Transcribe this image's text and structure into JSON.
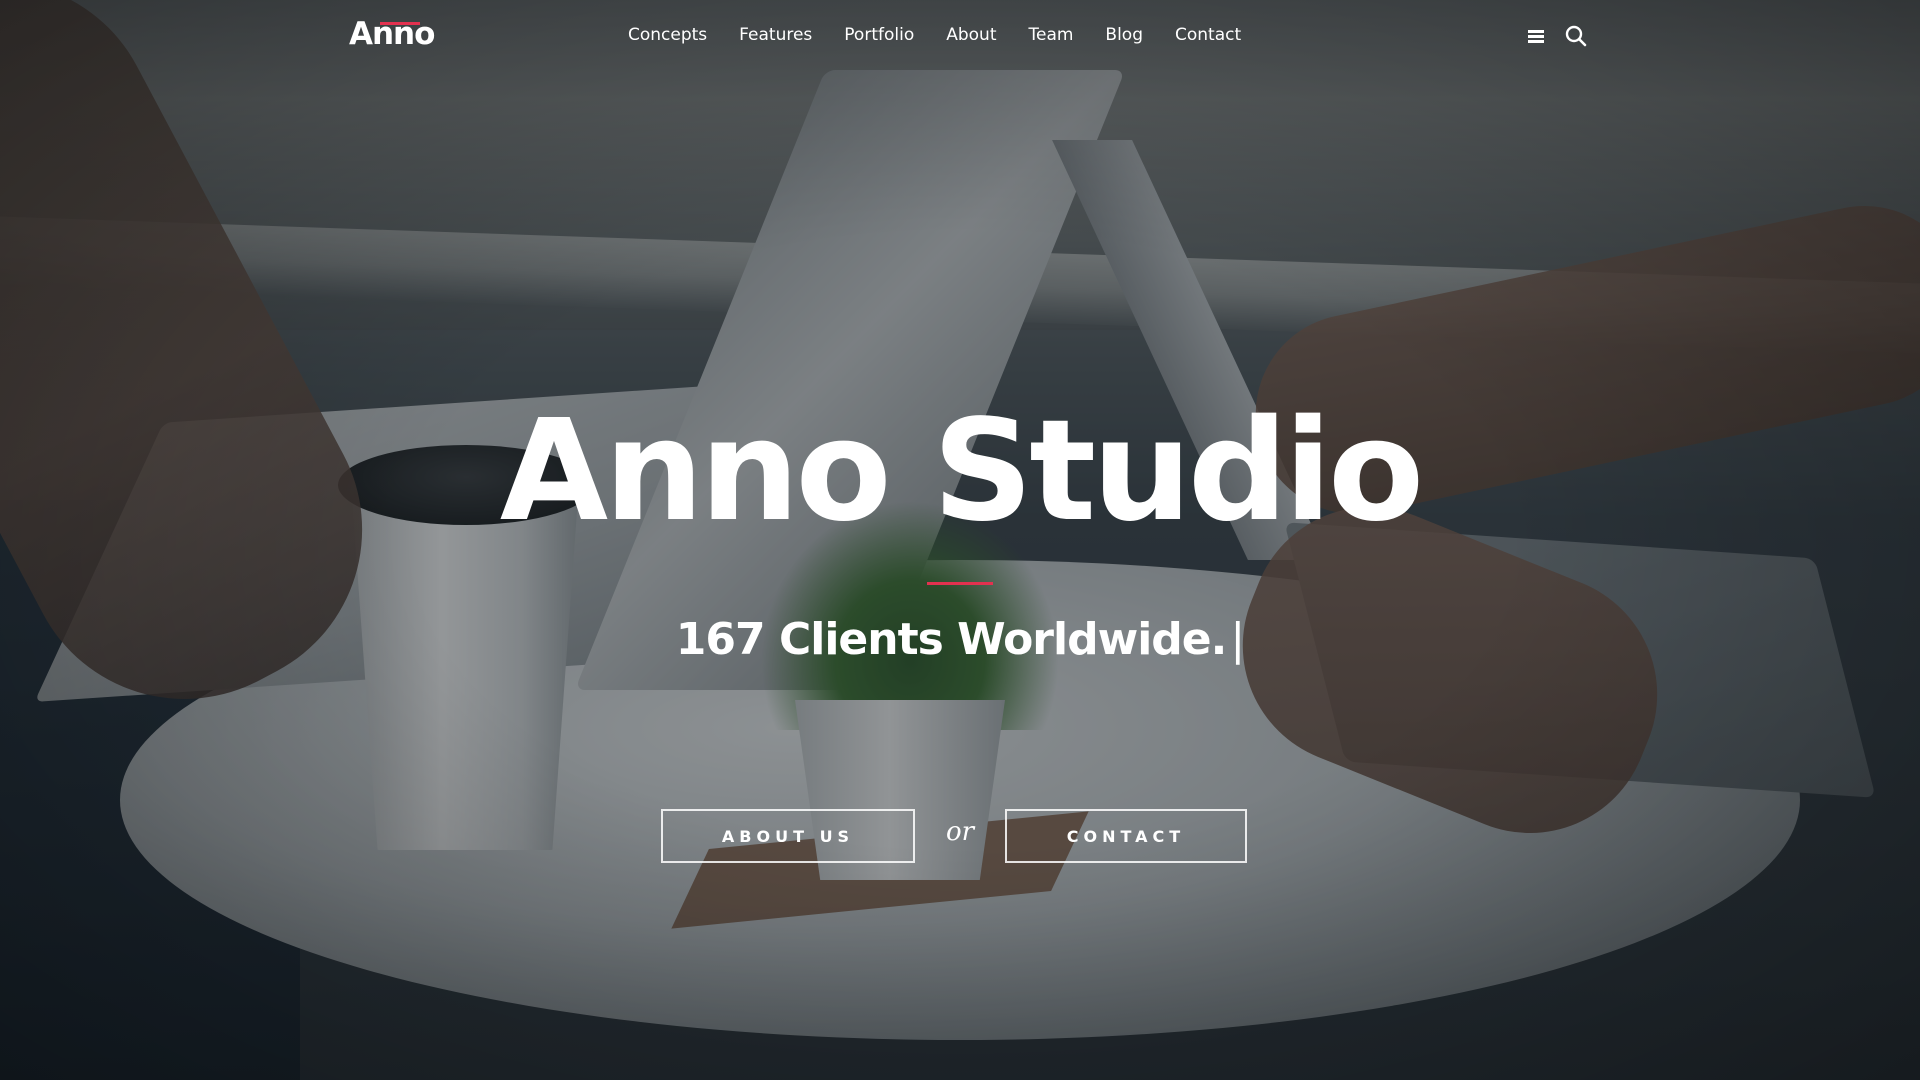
{
  "brand": {
    "logo_text": "Anno",
    "accent_color": "#e3314f"
  },
  "nav": {
    "items": [
      {
        "label": "Concepts"
      },
      {
        "label": "Features"
      },
      {
        "label": "Portfolio"
      },
      {
        "label": "About"
      },
      {
        "label": "Team"
      },
      {
        "label": "Blog"
      },
      {
        "label": "Contact"
      }
    ]
  },
  "header_icons": {
    "menu": "menu-icon",
    "search": "search-icon"
  },
  "hero": {
    "title": "Anno Studio",
    "subtitle": "167 Clients Worldwide.",
    "cursor": "|",
    "about_button": "About us",
    "or_text": "or",
    "contact_button": "Contact"
  }
}
